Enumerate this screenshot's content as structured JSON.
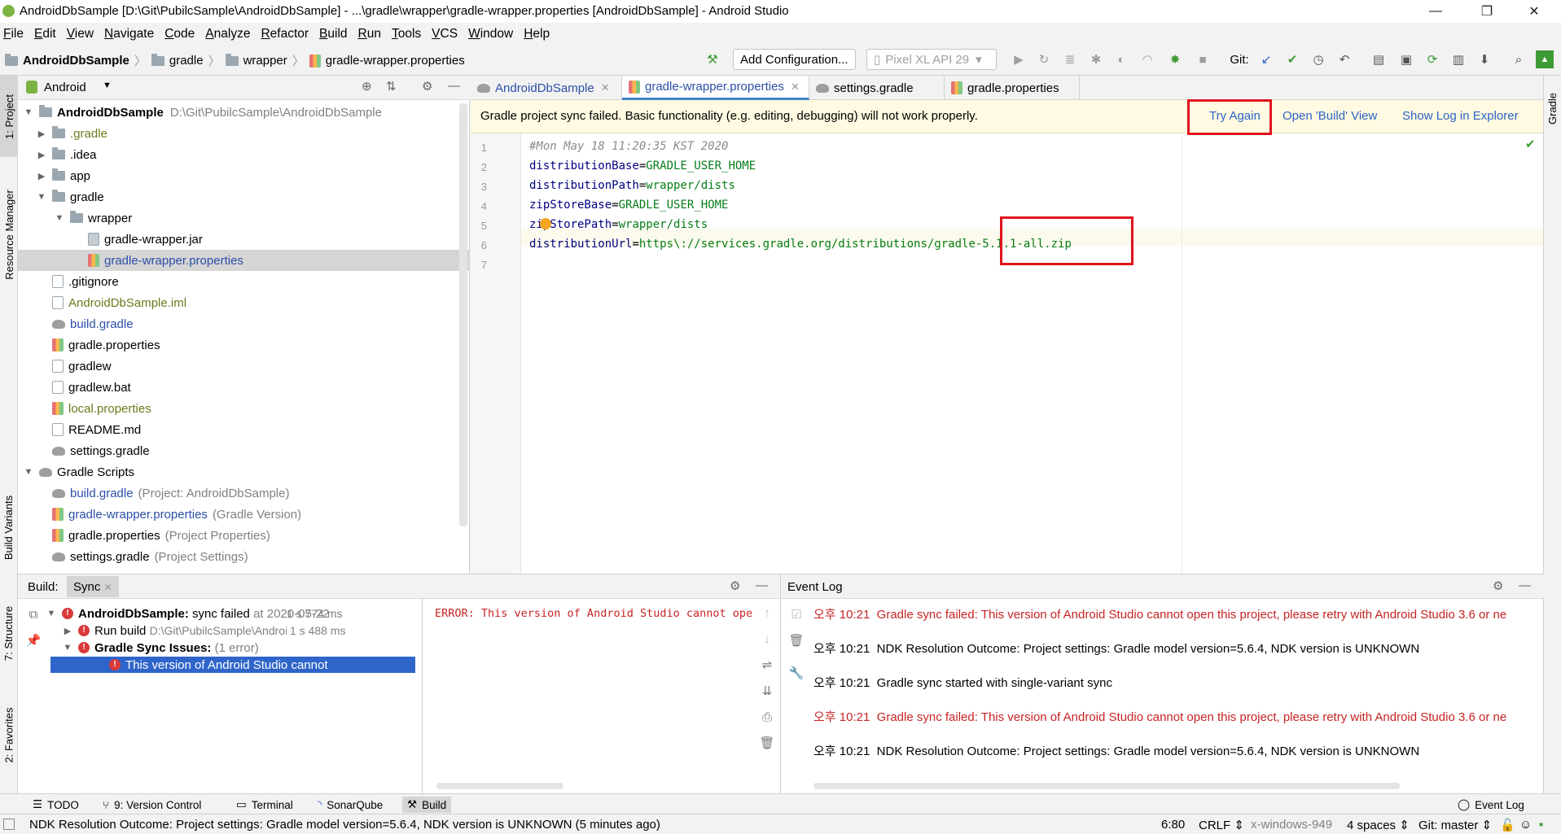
{
  "window": {
    "title": "AndroidDbSample [D:\\Git\\PubilcSample\\AndroidDbSample] - ...\\gradle\\wrapper\\gradle-wrapper.properties [AndroidDbSample] - Android Studio",
    "minimize": "—",
    "restore": "❐",
    "close": "✕"
  },
  "menu": [
    "File",
    "Edit",
    "View",
    "Navigate",
    "Code",
    "Analyze",
    "Refactor",
    "Build",
    "Run",
    "Tools",
    "VCS",
    "Window",
    "Help"
  ],
  "breadcrumb": {
    "project": "AndroidDbSample",
    "folder1": "gradle",
    "folder2": "wrapper",
    "file": "gradle-wrapper.properties"
  },
  "toolbar": {
    "add_configuration": "Add Configuration...",
    "device": "Pixel XL API 29",
    "git_label": "Git:"
  },
  "left_stripe": {
    "project": "1: Project",
    "resource_manager": "Resource Manager",
    "build_variants": "Build Variants",
    "structure": "7: Structure",
    "favorites": "2: Favorites"
  },
  "right_stripe": {
    "gradle": "Gradle"
  },
  "project_panel": {
    "view_mode": "Android",
    "tree": [
      {
        "label": "AndroidDbSample",
        "hint": "D:\\Git\\PubilcSample\\AndroidDbSample"
      },
      {
        "label": ".gradle"
      },
      {
        "label": ".idea"
      },
      {
        "label": "app"
      },
      {
        "label": "gradle"
      },
      {
        "label": "wrapper"
      },
      {
        "label": "gradle-wrapper.jar"
      },
      {
        "label": "gradle-wrapper.properties"
      },
      {
        "label": ".gitignore"
      },
      {
        "label": "AndroidDbSample.iml"
      },
      {
        "label": "build.gradle"
      },
      {
        "label": "gradle.properties"
      },
      {
        "label": "gradlew"
      },
      {
        "label": "gradlew.bat"
      },
      {
        "label": "local.properties"
      },
      {
        "label": "README.md"
      },
      {
        "label": "settings.gradle"
      },
      {
        "label": "Gradle Scripts"
      },
      {
        "label": "build.gradle",
        "hint": "(Project: AndroidDbSample)"
      },
      {
        "label": "gradle-wrapper.properties",
        "hint": "(Gradle Version)"
      },
      {
        "label": "gradle.properties",
        "hint": "(Project Properties)"
      },
      {
        "label": "settings.gradle",
        "hint": "(Project Settings)"
      }
    ]
  },
  "editor_tabs": [
    {
      "label": "AndroidDbSample"
    },
    {
      "label": "gradle-wrapper.properties"
    },
    {
      "label": "settings.gradle"
    },
    {
      "label": "gradle.properties"
    }
  ],
  "banner": {
    "message": "Gradle project sync failed. Basic functionality (e.g. editing, debugging) will not work properly.",
    "try_again": "Try Again",
    "open_build": "Open 'Build' View",
    "show_log": "Show Log in Explorer"
  },
  "code_lines": [
    {
      "n": "1",
      "key": "#Mon May 18 11:20:35 KST 2020",
      "val": ""
    },
    {
      "n": "2",
      "key": "distributionBase",
      "val": "GRADLE_USER_HOME"
    },
    {
      "n": "3",
      "key": "distributionPath",
      "val": "wrapper/dists"
    },
    {
      "n": "4",
      "key": "zipStoreBase",
      "val": "GRADLE_USER_HOME"
    },
    {
      "n": "5",
      "key": "zipStorePath",
      "val": "wrapper/dists"
    },
    {
      "n": "6",
      "key": "distributionUrl",
      "val": "https\\://services.gradle.org/distributions/gradle-5.1.1-all.zip"
    },
    {
      "n": "7",
      "key": "",
      "val": ""
    }
  ],
  "build_panel": {
    "title": "Build:",
    "tab": "Sync",
    "rows": [
      {
        "label": "AndroidDbSample:",
        "text": "sync failed",
        "hint": "at 2020-05-22",
        "time": "1 s 774 ms"
      },
      {
        "label": "Run build",
        "hint": "D:\\Git\\PubilcSample\\Androic",
        "time": "1 s 488 ms"
      },
      {
        "label": "Gradle Sync Issues:",
        "hint": "(1 error)"
      },
      {
        "label": "This version of Android Studio cannot"
      }
    ],
    "console": "ERROR: This version of Android Studio cannot ope"
  },
  "event_log": {
    "title": "Event Log",
    "rows": [
      {
        "time": "오후 10:21",
        "text": "Gradle sync failed: This version of Android Studio cannot open this project, please retry with Android Studio 3.6 or ne",
        "error": true
      },
      {
        "time": "오후 10:21",
        "text": "NDK Resolution Outcome: Project settings: Gradle model version=5.6.4, NDK version is UNKNOWN",
        "error": false
      },
      {
        "time": "오후 10:21",
        "text": "Gradle sync started with single-variant sync",
        "error": false
      },
      {
        "time": "오후 10:21",
        "text": "Gradle sync failed: This version of Android Studio cannot open this project, please retry with Android Studio 3.6 or ne",
        "error": true
      },
      {
        "time": "오후 10:21",
        "text": "NDK Resolution Outcome: Project settings: Gradle model version=5.6.4, NDK version is UNKNOWN",
        "error": false
      }
    ]
  },
  "bottom_tabs": {
    "todo": "TODO",
    "version_control": "9: Version Control",
    "terminal": "Terminal",
    "sonarqube": "SonarQube",
    "build": "Build",
    "event_log": "Event Log"
  },
  "status": {
    "message": "NDK Resolution Outcome: Project settings: Gradle model version=5.6.4, NDK version is UNKNOWN (5 minutes ago)",
    "position": "6:80",
    "line_ending": "CRLF",
    "encoding": "x-windows-949",
    "indent": "4 spaces",
    "git": "Git: master"
  }
}
